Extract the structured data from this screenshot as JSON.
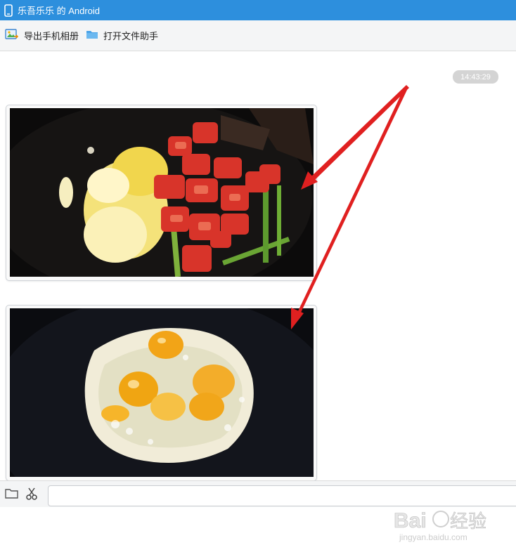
{
  "window": {
    "title": "乐吾乐乐 的 Android"
  },
  "toolbar": {
    "export_album_label": "导出手机相册",
    "open_file_helper_label": "打开文件助手"
  },
  "chat": {
    "timestamp": "14:43:29",
    "messages": [
      {
        "type": "image",
        "subject": "scrambled eggs with tomato and celery in wok"
      },
      {
        "type": "image",
        "subject": "fried eggs in wok"
      }
    ]
  },
  "input": {
    "value": "",
    "placeholder": ""
  },
  "icons": {
    "title": "phone-icon",
    "export_album": "image-export-icon",
    "open_file_helper": "folder-icon",
    "input_folder": "folder-icon",
    "input_screenshot": "scissors-icon"
  },
  "colors": {
    "titlebar": "#2d8fdd",
    "toolbar": "#f4f5f6",
    "timestamp_badge": "#d4d4d4",
    "annotation_arrow": "#e02020"
  },
  "watermark": {
    "brand": "Baidu经验",
    "url": "jingyan.baidu.com"
  }
}
